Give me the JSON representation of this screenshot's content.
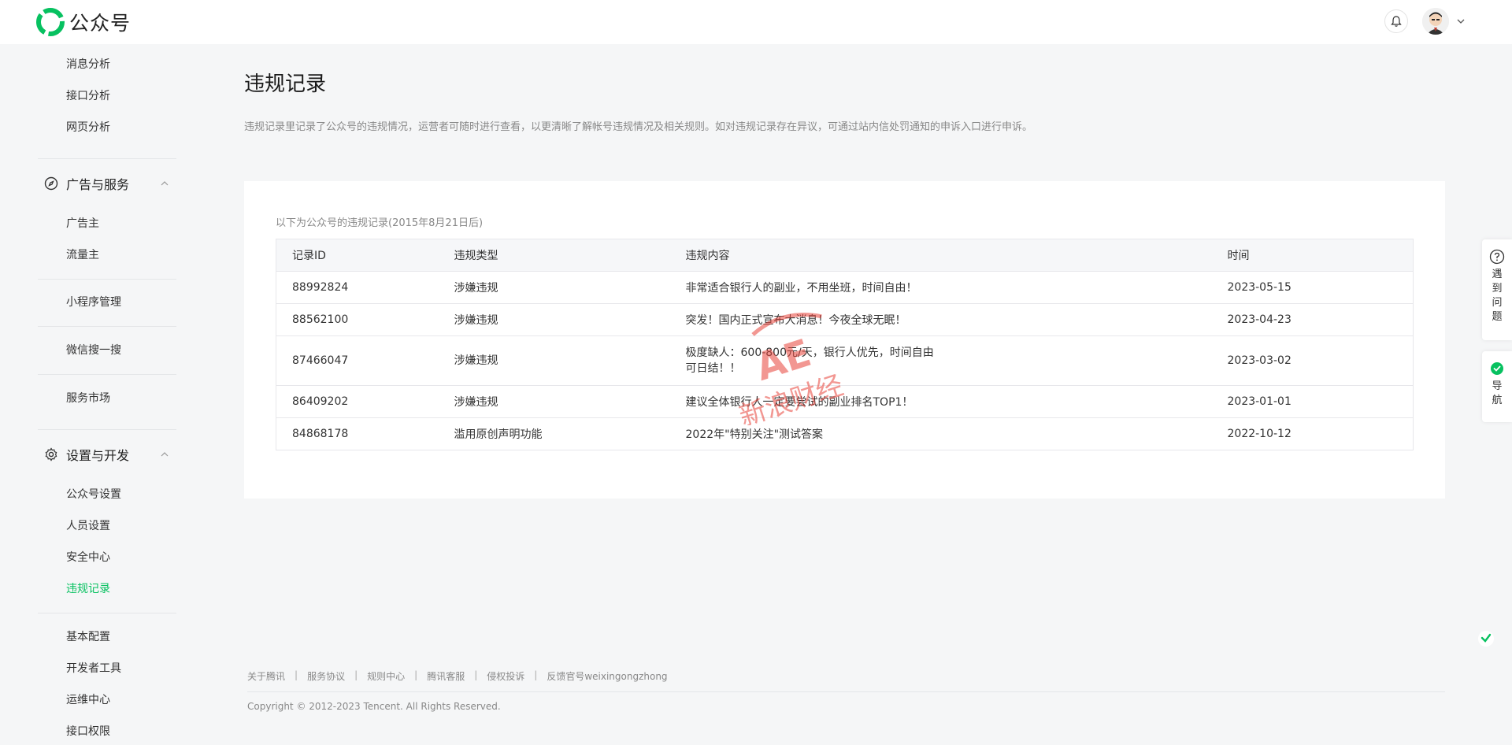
{
  "header": {
    "logo_text": "公众号"
  },
  "sidebar": {
    "top_items": [
      {
        "label": "消息分析"
      },
      {
        "label": "接口分析"
      },
      {
        "label": "网页分析"
      }
    ],
    "ads_group": {
      "label": "广告与服务"
    },
    "ads_items": [
      {
        "label": "广告主"
      },
      {
        "label": "流量主"
      }
    ],
    "standalone": [
      {
        "label": "小程序管理"
      },
      {
        "label": "微信搜一搜"
      },
      {
        "label": "服务市场"
      }
    ],
    "settings_group": {
      "label": "设置与开发"
    },
    "settings_items": [
      {
        "label": "公众号设置"
      },
      {
        "label": "人员设置"
      },
      {
        "label": "安全中心"
      },
      {
        "label": "违规记录"
      }
    ],
    "dev_items": [
      {
        "label": "基本配置"
      },
      {
        "label": "开发者工具"
      },
      {
        "label": "运维中心"
      },
      {
        "label": "接口权限"
      }
    ]
  },
  "main": {
    "title": "违规记录",
    "description": "违规记录里记录了公众号的违规情况，运营者可随时进行查看，以更清晰了解帐号违规情况及相关规则。如对违规记录存在异议，可通过站内信处罚通知的申诉入口进行申诉。",
    "table_caption": "以下为公众号的违规记录(2015年8月21日后)",
    "columns": {
      "id": "记录ID",
      "type": "违规类型",
      "content": "违规内容",
      "time": "时间"
    },
    "rows": [
      {
        "id": "88992824",
        "type": "涉嫌违规",
        "content": "非常适合银行人的副业，不用坐班，时间自由！",
        "time": "2023-05-15"
      },
      {
        "id": "88562100",
        "type": "涉嫌违规",
        "content": "突发！国内正式宣布大消息！今夜全球无眠！",
        "time": "2023-04-23"
      },
      {
        "id": "87466047",
        "type": "涉嫌违规",
        "content": "极度缺人：600-800元/天，银行人优先，时间自由可日结！！",
        "time": "2023-03-02"
      },
      {
        "id": "86409202",
        "type": "涉嫌违规",
        "content": "建议全体银行人一定要尝试的副业排名TOP1！",
        "time": "2023-01-01"
      },
      {
        "id": "84868178",
        "type": "滥用原创声明功能",
        "content": "2022年\"特别关注\"测试答案",
        "time": "2022-10-12"
      }
    ]
  },
  "watermark": {
    "text": "新浪财经"
  },
  "float": {
    "help": [
      "遇",
      "到",
      "问",
      "题"
    ],
    "nav": [
      "导",
      "航"
    ]
  },
  "footer": {
    "links": [
      {
        "label": "关于腾讯"
      },
      {
        "label": "服务协议"
      },
      {
        "label": "规则中心"
      },
      {
        "label": "腾讯客服"
      },
      {
        "label": "侵权投诉"
      },
      {
        "label": "反馈官号weixingongzhong"
      }
    ],
    "copyright": "Copyright © 2012-2023 Tencent. All Rights Reserved."
  },
  "colors": {
    "accent": "#07c160",
    "background": "#f5f6f7",
    "watermark": "#e8433a"
  }
}
